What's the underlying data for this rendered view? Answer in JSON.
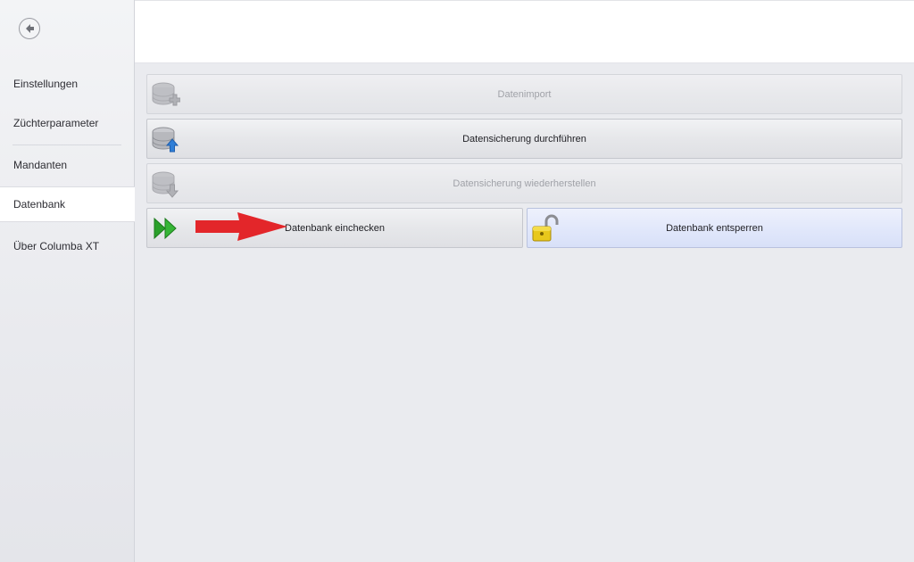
{
  "sidebar": {
    "back_icon": "back-arrow-icon",
    "items": [
      {
        "label": "Einstellungen"
      },
      {
        "label": "Züchterparameter"
      },
      {
        "label": "Mandanten"
      },
      {
        "label": "Datenbank",
        "active": true
      },
      {
        "label": "Über Columba XT"
      }
    ]
  },
  "actions": {
    "import": {
      "label": "Datenimport",
      "enabled": false,
      "icon": "database-add-icon"
    },
    "backup": {
      "label": "Datensicherung durchführen",
      "enabled": true,
      "icon": "database-upload-icon"
    },
    "restore": {
      "label": "Datensicherung wiederherstellen",
      "enabled": false,
      "icon": "database-download-icon"
    },
    "checkin": {
      "label": "Datenbank einchecken",
      "enabled": true,
      "icon": "fast-forward-icon"
    },
    "unlock": {
      "label": "Datenbank entsperren",
      "enabled": true,
      "icon": "open-padlock-icon"
    }
  },
  "annotation": {
    "icon": "red-arrow-icon",
    "color": "#e3262a"
  },
  "colors": {
    "accent_blue": "#2f7fd8",
    "green": "#2aa02a",
    "lock_yellow": "#e8c81c"
  }
}
